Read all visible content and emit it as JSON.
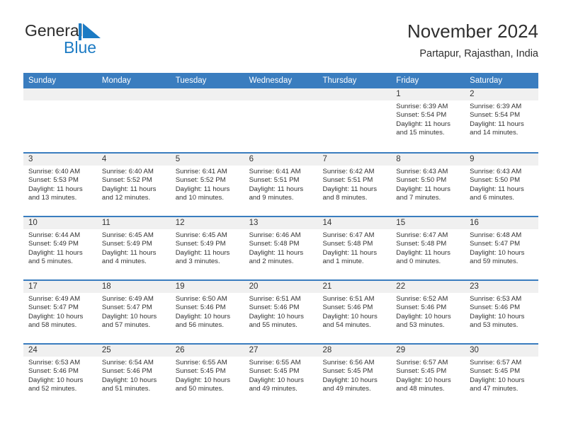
{
  "brand": {
    "name_part1": "General",
    "name_part2": "Blue"
  },
  "header": {
    "title": "November 2024",
    "subtitle": "Partapur, Rajasthan, India"
  },
  "colors": {
    "header_blue": "#3a7dbf",
    "band_gray": "#f0f0f0",
    "logo_blue": "#1c7bc4",
    "text": "#333333"
  },
  "weekdays": [
    "Sunday",
    "Monday",
    "Tuesday",
    "Wednesday",
    "Thursday",
    "Friday",
    "Saturday"
  ],
  "labels": {
    "sunrise": "Sunrise:",
    "sunset": "Sunset:",
    "daylight": "Daylight:"
  },
  "weeks": [
    [
      {
        "empty": true
      },
      {
        "empty": true
      },
      {
        "empty": true
      },
      {
        "empty": true
      },
      {
        "empty": true
      },
      {
        "day": "1",
        "sunrise": "Sunrise: 6:39 AM",
        "sunset": "Sunset: 5:54 PM",
        "daylight_l1": "Daylight: 11 hours",
        "daylight_l2": "and 15 minutes."
      },
      {
        "day": "2",
        "sunrise": "Sunrise: 6:39 AM",
        "sunset": "Sunset: 5:54 PM",
        "daylight_l1": "Daylight: 11 hours",
        "daylight_l2": "and 14 minutes."
      }
    ],
    [
      {
        "day": "3",
        "sunrise": "Sunrise: 6:40 AM",
        "sunset": "Sunset: 5:53 PM",
        "daylight_l1": "Daylight: 11 hours",
        "daylight_l2": "and 13 minutes."
      },
      {
        "day": "4",
        "sunrise": "Sunrise: 6:40 AM",
        "sunset": "Sunset: 5:52 PM",
        "daylight_l1": "Daylight: 11 hours",
        "daylight_l2": "and 12 minutes."
      },
      {
        "day": "5",
        "sunrise": "Sunrise: 6:41 AM",
        "sunset": "Sunset: 5:52 PM",
        "daylight_l1": "Daylight: 11 hours",
        "daylight_l2": "and 10 minutes."
      },
      {
        "day": "6",
        "sunrise": "Sunrise: 6:41 AM",
        "sunset": "Sunset: 5:51 PM",
        "daylight_l1": "Daylight: 11 hours",
        "daylight_l2": "and 9 minutes."
      },
      {
        "day": "7",
        "sunrise": "Sunrise: 6:42 AM",
        "sunset": "Sunset: 5:51 PM",
        "daylight_l1": "Daylight: 11 hours",
        "daylight_l2": "and 8 minutes."
      },
      {
        "day": "8",
        "sunrise": "Sunrise: 6:43 AM",
        "sunset": "Sunset: 5:50 PM",
        "daylight_l1": "Daylight: 11 hours",
        "daylight_l2": "and 7 minutes."
      },
      {
        "day": "9",
        "sunrise": "Sunrise: 6:43 AM",
        "sunset": "Sunset: 5:50 PM",
        "daylight_l1": "Daylight: 11 hours",
        "daylight_l2": "and 6 minutes."
      }
    ],
    [
      {
        "day": "10",
        "sunrise": "Sunrise: 6:44 AM",
        "sunset": "Sunset: 5:49 PM",
        "daylight_l1": "Daylight: 11 hours",
        "daylight_l2": "and 5 minutes."
      },
      {
        "day": "11",
        "sunrise": "Sunrise: 6:45 AM",
        "sunset": "Sunset: 5:49 PM",
        "daylight_l1": "Daylight: 11 hours",
        "daylight_l2": "and 4 minutes."
      },
      {
        "day": "12",
        "sunrise": "Sunrise: 6:45 AM",
        "sunset": "Sunset: 5:49 PM",
        "daylight_l1": "Daylight: 11 hours",
        "daylight_l2": "and 3 minutes."
      },
      {
        "day": "13",
        "sunrise": "Sunrise: 6:46 AM",
        "sunset": "Sunset: 5:48 PM",
        "daylight_l1": "Daylight: 11 hours",
        "daylight_l2": "and 2 minutes."
      },
      {
        "day": "14",
        "sunrise": "Sunrise: 6:47 AM",
        "sunset": "Sunset: 5:48 PM",
        "daylight_l1": "Daylight: 11 hours",
        "daylight_l2": "and 1 minute."
      },
      {
        "day": "15",
        "sunrise": "Sunrise: 6:47 AM",
        "sunset": "Sunset: 5:48 PM",
        "daylight_l1": "Daylight: 11 hours",
        "daylight_l2": "and 0 minutes."
      },
      {
        "day": "16",
        "sunrise": "Sunrise: 6:48 AM",
        "sunset": "Sunset: 5:47 PM",
        "daylight_l1": "Daylight: 10 hours",
        "daylight_l2": "and 59 minutes."
      }
    ],
    [
      {
        "day": "17",
        "sunrise": "Sunrise: 6:49 AM",
        "sunset": "Sunset: 5:47 PM",
        "daylight_l1": "Daylight: 10 hours",
        "daylight_l2": "and 58 minutes."
      },
      {
        "day": "18",
        "sunrise": "Sunrise: 6:49 AM",
        "sunset": "Sunset: 5:47 PM",
        "daylight_l1": "Daylight: 10 hours",
        "daylight_l2": "and 57 minutes."
      },
      {
        "day": "19",
        "sunrise": "Sunrise: 6:50 AM",
        "sunset": "Sunset: 5:46 PM",
        "daylight_l1": "Daylight: 10 hours",
        "daylight_l2": "and 56 minutes."
      },
      {
        "day": "20",
        "sunrise": "Sunrise: 6:51 AM",
        "sunset": "Sunset: 5:46 PM",
        "daylight_l1": "Daylight: 10 hours",
        "daylight_l2": "and 55 minutes."
      },
      {
        "day": "21",
        "sunrise": "Sunrise: 6:51 AM",
        "sunset": "Sunset: 5:46 PM",
        "daylight_l1": "Daylight: 10 hours",
        "daylight_l2": "and 54 minutes."
      },
      {
        "day": "22",
        "sunrise": "Sunrise: 6:52 AM",
        "sunset": "Sunset: 5:46 PM",
        "daylight_l1": "Daylight: 10 hours",
        "daylight_l2": "and 53 minutes."
      },
      {
        "day": "23",
        "sunrise": "Sunrise: 6:53 AM",
        "sunset": "Sunset: 5:46 PM",
        "daylight_l1": "Daylight: 10 hours",
        "daylight_l2": "and 53 minutes."
      }
    ],
    [
      {
        "day": "24",
        "sunrise": "Sunrise: 6:53 AM",
        "sunset": "Sunset: 5:46 PM",
        "daylight_l1": "Daylight: 10 hours",
        "daylight_l2": "and 52 minutes."
      },
      {
        "day": "25",
        "sunrise": "Sunrise: 6:54 AM",
        "sunset": "Sunset: 5:46 PM",
        "daylight_l1": "Daylight: 10 hours",
        "daylight_l2": "and 51 minutes."
      },
      {
        "day": "26",
        "sunrise": "Sunrise: 6:55 AM",
        "sunset": "Sunset: 5:45 PM",
        "daylight_l1": "Daylight: 10 hours",
        "daylight_l2": "and 50 minutes."
      },
      {
        "day": "27",
        "sunrise": "Sunrise: 6:55 AM",
        "sunset": "Sunset: 5:45 PM",
        "daylight_l1": "Daylight: 10 hours",
        "daylight_l2": "and 49 minutes."
      },
      {
        "day": "28",
        "sunrise": "Sunrise: 6:56 AM",
        "sunset": "Sunset: 5:45 PM",
        "daylight_l1": "Daylight: 10 hours",
        "daylight_l2": "and 49 minutes."
      },
      {
        "day": "29",
        "sunrise": "Sunrise: 6:57 AM",
        "sunset": "Sunset: 5:45 PM",
        "daylight_l1": "Daylight: 10 hours",
        "daylight_l2": "and 48 minutes."
      },
      {
        "day": "30",
        "sunrise": "Sunrise: 6:57 AM",
        "sunset": "Sunset: 5:45 PM",
        "daylight_l1": "Daylight: 10 hours",
        "daylight_l2": "and 47 minutes."
      }
    ]
  ]
}
